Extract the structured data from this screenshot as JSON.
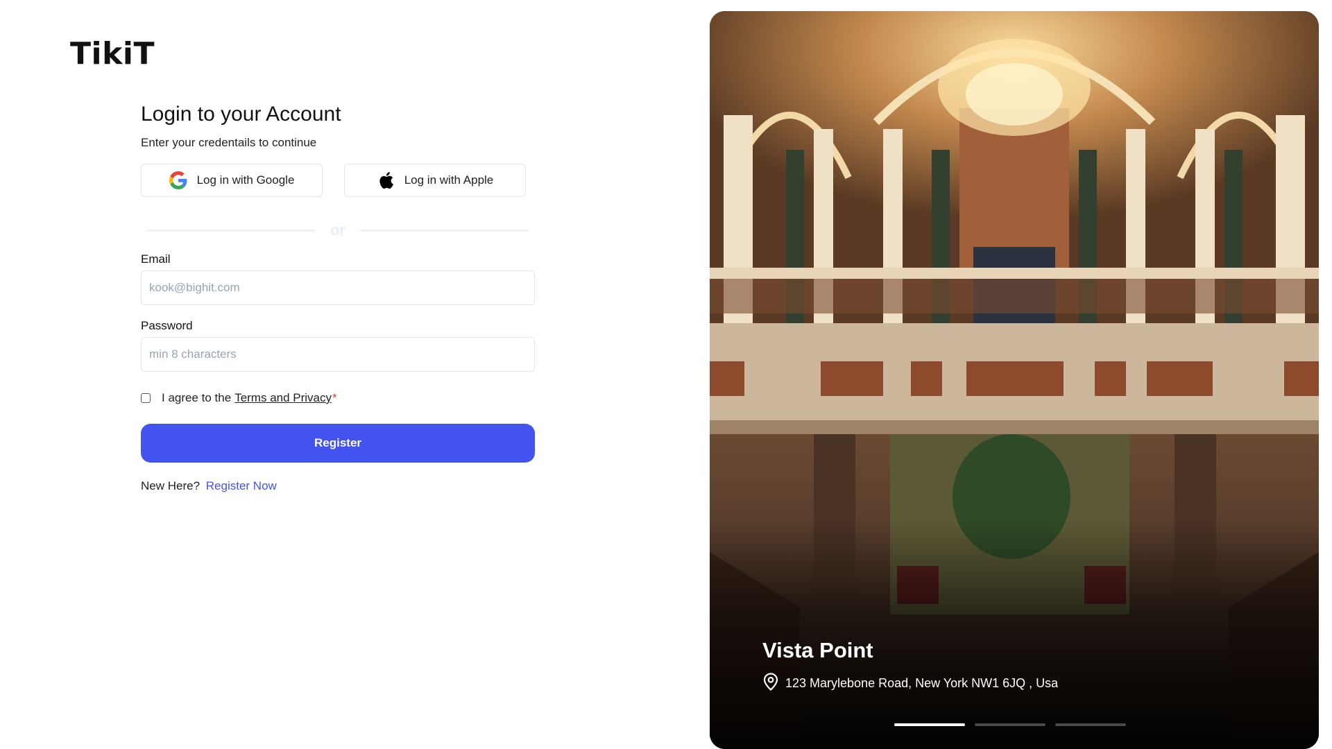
{
  "brand": {
    "name": "TikiT"
  },
  "login": {
    "title": "Login to your Account",
    "subtitle": "Enter your credentails to continue",
    "google_label": "Log in with Google",
    "apple_label": "Log in with Apple",
    "divider": "or",
    "email_label": "Email",
    "email_placeholder": "kook@bighit.com",
    "email_value": "",
    "password_label": "Password",
    "password_placeholder": "min 8 characters",
    "password_value": "",
    "agree_prefix": "I agree to the",
    "agree_link": "Terms and Privacy",
    "required_mark": "*",
    "agree_checked": false,
    "register_label": "Register",
    "new_here": "New Here?",
    "register_now": "Register Now"
  },
  "hero": {
    "venue_name": "Vista Point",
    "venue_address": "123 Marylebone Road, New York NW1 6JQ , Usa",
    "slides_total": 3,
    "active_slide": 1
  },
  "icons": {
    "google": "google-icon",
    "apple": "apple-icon",
    "location": "location-pin-icon"
  },
  "colors": {
    "primary": "#4353f0",
    "border": "#dfe4ee",
    "placeholder": "#9aa3b3",
    "required": "#e53935"
  }
}
